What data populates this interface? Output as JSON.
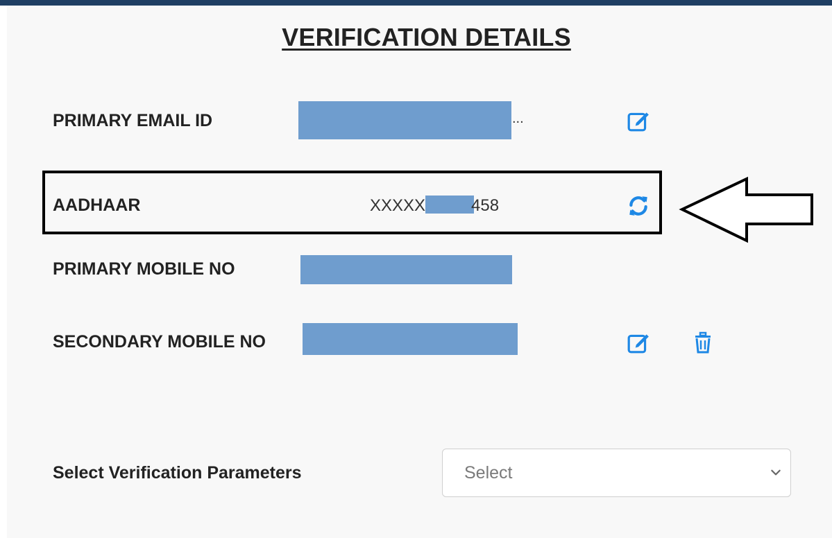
{
  "page": {
    "title": "VERIFICATION DETAILS"
  },
  "rows": {
    "primary_email": {
      "label": "PRIMARY EMAIL ID",
      "ellipsis": "..."
    },
    "aadhaar": {
      "label": "AADHAAR",
      "prefix": "XXXXX",
      "suffix": "458"
    },
    "primary_mobile": {
      "label": "PRIMARY MOBILE NO"
    },
    "secondary_mobile": {
      "label": "SECONDARY MOBILE NO"
    }
  },
  "verification": {
    "label": "Select Verification Parameters",
    "selected": "Select"
  },
  "icons": {
    "edit": "edit-icon",
    "refresh": "refresh-icon",
    "delete": "trash-icon",
    "arrow": "left-arrow-annotation",
    "dropdown": "chevron-down-icon"
  },
  "colors": {
    "accent": "#1e88e5",
    "redaction": "#6f9dce",
    "header_bar": "#1f3f63"
  }
}
